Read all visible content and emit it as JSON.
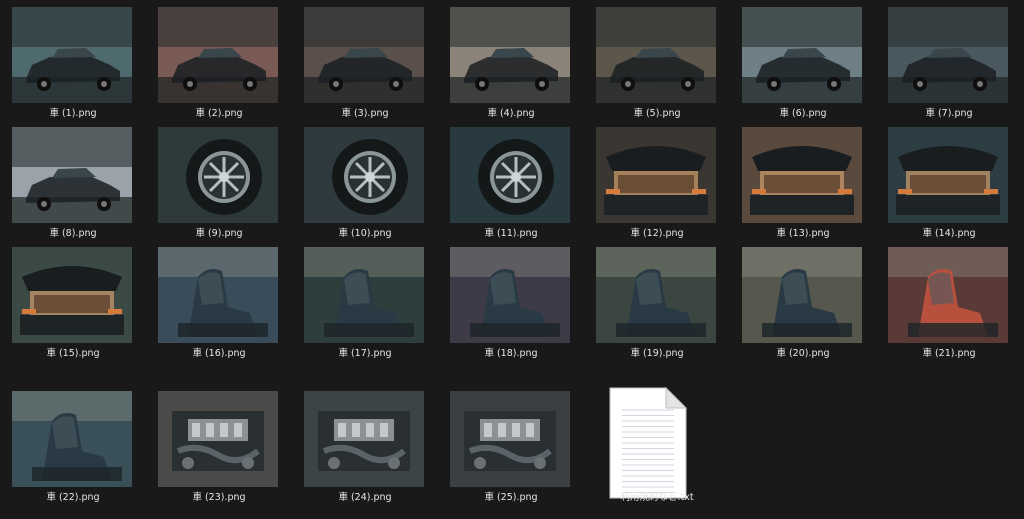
{
  "explorer": {
    "items": [
      {
        "filename": "車 (1).png",
        "subject": "vintage sedan on street",
        "palette": "#4f6a6e"
      },
      {
        "filename": "車 (2).png",
        "subject": "vintage sedan on street",
        "palette": "#7a5a55"
      },
      {
        "filename": "車 (3).png",
        "subject": "sedan rear view",
        "palette": "#5a4f4a"
      },
      {
        "filename": "車 (4).png",
        "subject": "sedan rear view",
        "palette": "#8b8278"
      },
      {
        "filename": "車 (5).png",
        "subject": "sedan side view",
        "palette": "#5d564b"
      },
      {
        "filename": "車 (6).png",
        "subject": "sedan side view",
        "palette": "#6e7f86"
      },
      {
        "filename": "車 (7).png",
        "subject": "modern sedan",
        "palette": "#4a5860"
      },
      {
        "filename": "車 (8).png",
        "subject": "silver sedan",
        "palette": "#9aa3aa"
      },
      {
        "filename": "車 (9).png",
        "subject": "wheel close-up",
        "palette": "#2e3a3a"
      },
      {
        "filename": "車 (10).png",
        "subject": "wheel close-up",
        "palette": "#2f3a3e"
      },
      {
        "filename": "車 (11).png",
        "subject": "wheel close-up",
        "palette": "#283a40"
      },
      {
        "filename": "車 (12).png",
        "subject": "open trunk",
        "palette": "#3a3632"
      },
      {
        "filename": "車 (13).png",
        "subject": "open trunk",
        "palette": "#5a4a3e"
      },
      {
        "filename": "車 (14).png",
        "subject": "open trunk",
        "palette": "#2c3e44"
      },
      {
        "filename": "車 (15).png",
        "subject": "open trunk",
        "palette": "#3b4a44"
      },
      {
        "filename": "車 (16).png",
        "subject": "interior seats",
        "palette": "#3a4c5a"
      },
      {
        "filename": "車 (17).png",
        "subject": "interior seats",
        "palette": "#2e3e3c"
      },
      {
        "filename": "車 (18).png",
        "subject": "interior seats",
        "palette": "#3e3a48"
      },
      {
        "filename": "車 (19).png",
        "subject": "interior seats",
        "palette": "#3b4640"
      },
      {
        "filename": "車 (20).png",
        "subject": "interior seats",
        "palette": "#56584e"
      },
      {
        "filename": "車 (21).png",
        "subject": "red interior",
        "palette": "#5a3a36"
      },
      {
        "filename": "車 (22).png",
        "subject": "interior seat",
        "palette": "#3a5058"
      },
      {
        "filename": "車 (23).png",
        "subject": "engine bay",
        "palette": "#4a4a48"
      },
      {
        "filename": "車 (24).png",
        "subject": "engine bay",
        "palette": "#3c4448"
      },
      {
        "filename": "車 (25).png",
        "subject": "engine bay",
        "palette": "#3a4042"
      },
      {
        "filename": "利用規約など.txt",
        "subject": "text document",
        "palette": "#ffffff"
      }
    ]
  },
  "colors": {
    "background": "#191919",
    "label_text": "#e6e6e6"
  }
}
